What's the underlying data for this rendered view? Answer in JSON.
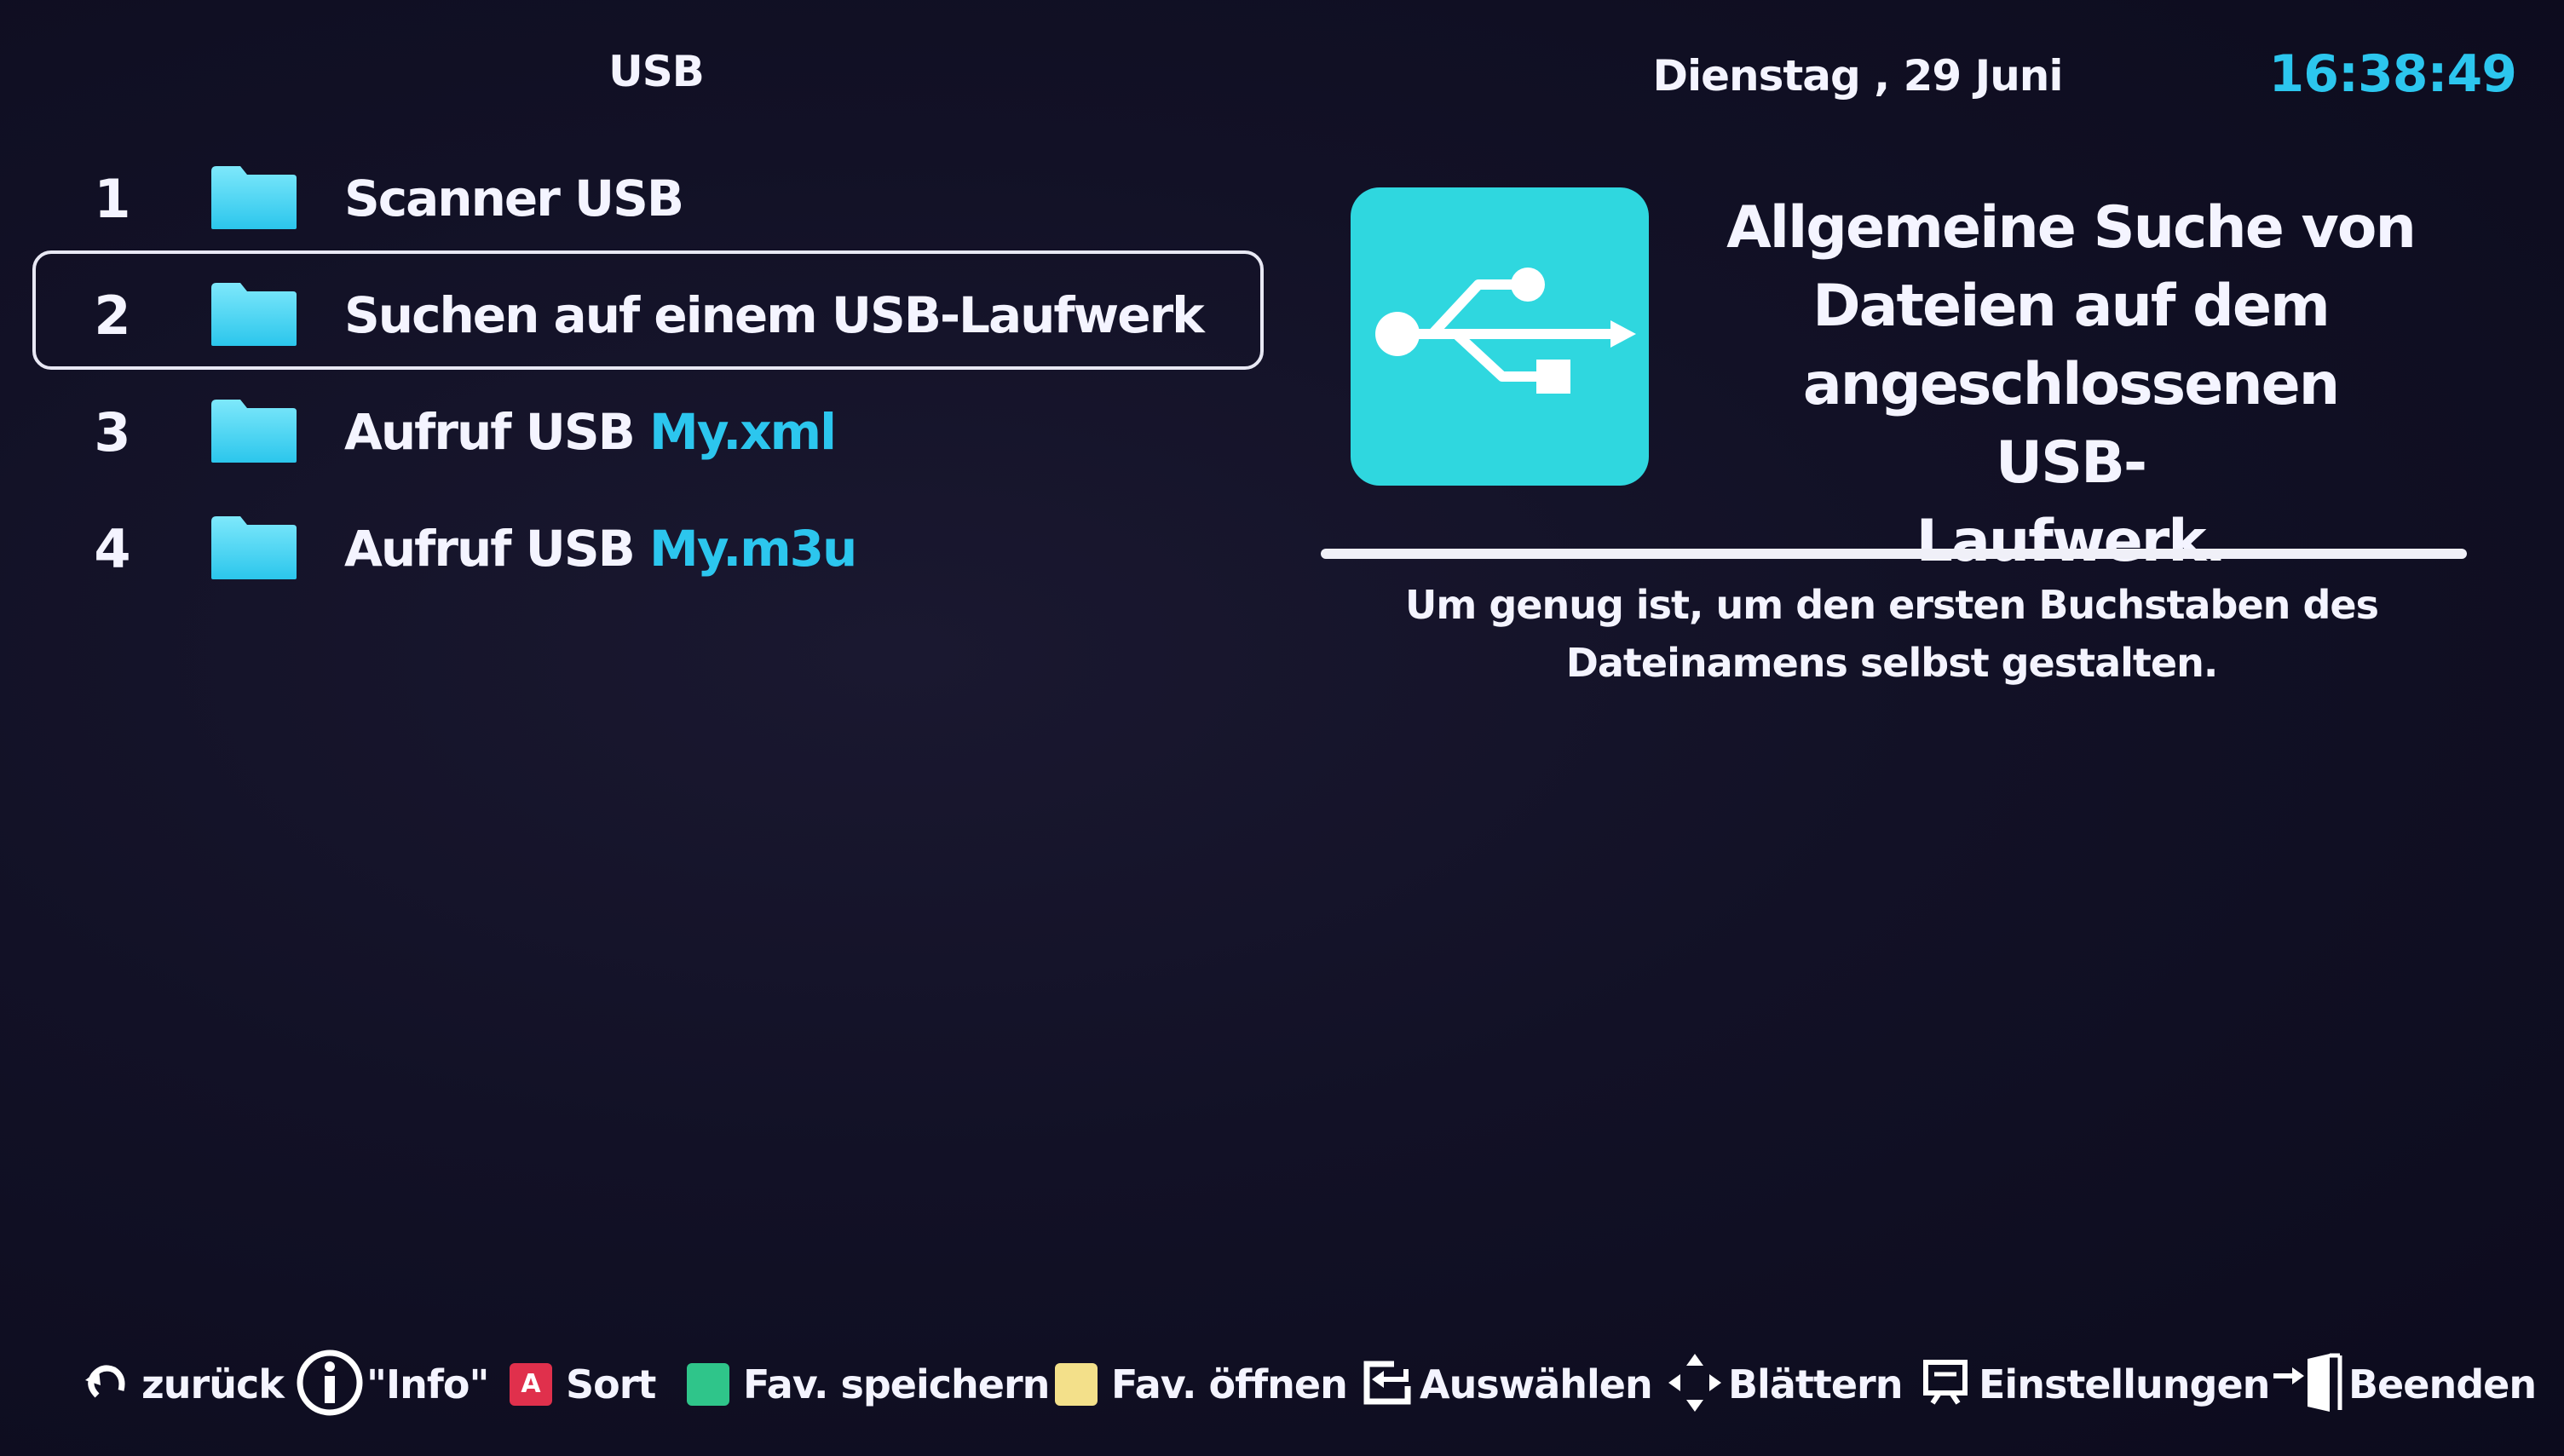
{
  "header": {
    "title": "USB",
    "date": "Dienstag , 29 Juni",
    "time": "16:38:49"
  },
  "menu": {
    "selected_index": 1,
    "items": [
      {
        "number": "1",
        "label": "Scanner USB",
        "highlight": "",
        "icon": "folder-icon"
      },
      {
        "number": "2",
        "label": "Suchen auf einem USB-Laufwerk",
        "highlight": "",
        "icon": "folder-icon"
      },
      {
        "number": "3",
        "label": "Aufruf USB ",
        "highlight": "My.xml",
        "icon": "folder-icon"
      },
      {
        "number": "4",
        "label": "Aufruf USB ",
        "highlight": "My.m3u",
        "icon": "folder-icon"
      }
    ]
  },
  "info_panel": {
    "icon": "usb-icon",
    "title_lines": [
      "Allgemeine Suche von",
      "Dateien auf dem",
      "angeschlossenen USB-",
      "Laufwerk."
    ],
    "description_lines": [
      "Um genug ist, um den ersten Buchstaben des",
      "Dateinamens selbst gestalten."
    ]
  },
  "footer": {
    "back": "zurück",
    "info": "\"Info\"",
    "red_key_letter": "A",
    "sort": "Sort",
    "fav_save": "Fav. speichern",
    "fav_open": "Fav. öffnen",
    "select": "Auswählen",
    "browse": "Blättern",
    "settings": "Einstellungen",
    "exit": "Beenden"
  },
  "colors": {
    "accent": "#2cc6ee",
    "usb_tile": "#2fd7df",
    "red_key": "#e0304c",
    "green_key": "#2fc58a",
    "yellow_key": "#f3e08a",
    "background": "#121126"
  }
}
